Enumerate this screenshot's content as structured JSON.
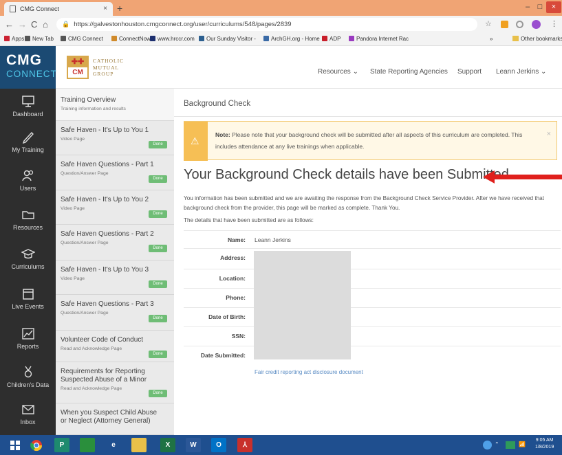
{
  "browser": {
    "tab_title": "CMG Connect",
    "tab_close": "×",
    "new_tab": "+",
    "win_min": "–",
    "win_max": "□",
    "win_close": "×",
    "url": "https://galvestonhouston.cmgconnect.org/user/curriculums/548/pages/2839",
    "nav_back": "←",
    "nav_forward": "→",
    "nav_reload": "C",
    "nav_home": "⌂",
    "bookmarks": [
      {
        "label": "Apps",
        "icon": "apps-grid-icon"
      },
      {
        "label": "New Tab",
        "icon": "page-icon"
      },
      {
        "label": "CMG Connect",
        "icon": "page-icon"
      },
      {
        "label": "ConnectNow",
        "icon": "connectnow-icon"
      },
      {
        "label": "www.hrccr.com",
        "icon": "sc-icon"
      },
      {
        "label": "Our Sunday Visitor -",
        "icon": "osv-icon"
      },
      {
        "label": "ArchGH.org - Home",
        "icon": "arch-icon"
      },
      {
        "label": "ADP",
        "icon": "adp-icon"
      },
      {
        "label": "Pandora Internet Rac",
        "icon": "pandora-icon"
      }
    ],
    "more_bookmarks": "»",
    "other_bookmarks": "Other bookmarks"
  },
  "header": {
    "logo_line1": "CMG",
    "logo_line2": "CONNECT",
    "partner_mark": "CM",
    "partner_line1": "CATHOLIC",
    "partner_line2": "MUTUAL",
    "partner_line3": "GROUP",
    "nav": [
      {
        "label": "Resources ⌄"
      },
      {
        "label": "State Reporting Agencies"
      },
      {
        "label": "Support"
      },
      {
        "label": "Leann Jerkins ⌄"
      }
    ]
  },
  "sidebar": {
    "items": [
      {
        "label": "Dashboard",
        "icon": "dashboard-icon"
      },
      {
        "label": "My Training",
        "icon": "pen-icon"
      },
      {
        "label": "Users",
        "icon": "users-icon"
      },
      {
        "label": "Resources",
        "icon": "folder-icon"
      },
      {
        "label": "Curriculums",
        "icon": "graduation-cap-icon"
      },
      {
        "label": "Live Events",
        "icon": "calendar-icon"
      },
      {
        "label": "Reports",
        "icon": "chart-icon"
      },
      {
        "label": "Children's Data",
        "icon": "medal-icon"
      },
      {
        "label": "Inbox",
        "icon": "mail-icon"
      }
    ]
  },
  "curriculum": {
    "items": [
      {
        "title": "Training Overview",
        "sub": "Training information and results",
        "status": ""
      },
      {
        "title": "Safe Haven - It's Up to You 1",
        "sub": "Video Page",
        "status": "Done"
      },
      {
        "title": "Safe Haven Questions - Part 1",
        "sub": "Question/Answer Page",
        "status": "Done"
      },
      {
        "title": "Safe Haven - It's Up to You 2",
        "sub": "Video Page",
        "status": "Done"
      },
      {
        "title": "Safe Haven Questions - Part 2",
        "sub": "Question/Answer Page",
        "status": "Done"
      },
      {
        "title": "Safe Haven - It's Up to You 3",
        "sub": "Video Page",
        "status": "Done"
      },
      {
        "title": "Safe Haven Questions - Part 3",
        "sub": "Question/Answer Page",
        "status": "Done"
      },
      {
        "title": "Volunteer Code of Conduct",
        "sub": "Read and Acknowledge Page",
        "status": "Done"
      },
      {
        "title": "Requirements for Reporting Suspected Abuse of a Minor",
        "sub": "Read and Acknowledge Page",
        "status": "Done"
      },
      {
        "title": "When you Suspect Child Abuse or Neglect (Attorney General)",
        "sub": "",
        "status": ""
      }
    ]
  },
  "main": {
    "breadcrumb": "Background Check",
    "note_label": "Note:",
    "note_text": " Please note that your background check will be submitted after all aspects of this curriculum are completed. This includes attendance at any live trainings when applicable.",
    "note_close": "×",
    "heading": "Your Background Check details have been Submitted",
    "paragraph": "You information has been submitted and we are awaiting the response from the Background Check Service Provider. After we have received that background check from the provider, this page will be marked as complete. Thank You.",
    "details_intro": "The details that have been submitted are as follows:",
    "fields": [
      {
        "label": "Name:",
        "value": "Leann Jerkins"
      },
      {
        "label": "Address:",
        "value": ""
      },
      {
        "label": "Location:",
        "value": ""
      },
      {
        "label": "Phone:",
        "value": ""
      },
      {
        "label": "Date of Birth:",
        "value": ""
      },
      {
        "label": "SSN:",
        "value": ""
      },
      {
        "label": "Date Submitted:",
        "value": ""
      }
    ],
    "fcra_link": "Fair credit reporting act disclosure document",
    "annotation_arrow_color": "#e0201c"
  },
  "taskbar": {
    "apps": [
      {
        "icon": "windows-start-icon",
        "glyph": "",
        "color": "#1f4f8f"
      },
      {
        "icon": "chrome-icon",
        "glyph": "",
        "color": "#1f4f8f"
      },
      {
        "icon": "publisher-icon",
        "glyph": "P",
        "color": "#1e8a6e"
      },
      {
        "icon": "store-icon",
        "glyph": "",
        "color": "#2a8f3c"
      },
      {
        "icon": "ie-icon",
        "glyph": "e",
        "color": "#1f4f8f"
      },
      {
        "icon": "file-explorer-icon",
        "glyph": "",
        "color": "#e8c04a"
      },
      {
        "icon": "excel-icon",
        "glyph": "X",
        "color": "#1f7244"
      },
      {
        "icon": "word-icon",
        "glyph": "W",
        "color": "#2b5797"
      },
      {
        "icon": "outlook-icon",
        "glyph": "O",
        "color": "#0072c6"
      },
      {
        "icon": "acrobat-icon",
        "glyph": "",
        "color": "#c8302c"
      }
    ],
    "time": "9:05 AM",
    "date": "1/8/2019"
  }
}
